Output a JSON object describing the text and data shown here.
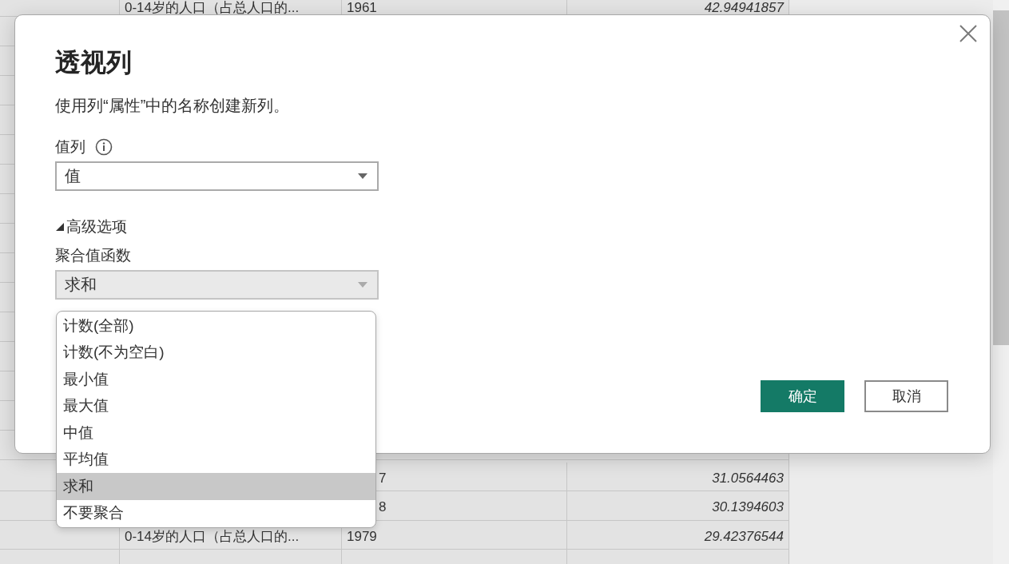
{
  "table": {
    "top_rows": [
      {
        "label": "0-14岁的人口（占总人口的...",
        "year": "1961",
        "value": "42.94941857"
      }
    ],
    "bottom_rows": [
      {
        "year": "7",
        "value": "31.0564463"
      },
      {
        "year": "8",
        "value": "30.1394603"
      },
      {
        "label": "0-14岁的人口（占总人口的...",
        "year": "1979",
        "value": "29.42376544"
      }
    ]
  },
  "dialog": {
    "title": "透视列",
    "description": "使用列“属性”中的名称创建新列。",
    "value_column": {
      "label": "值列",
      "value": "值"
    },
    "advanced": {
      "label": "高级选项",
      "expanded": true
    },
    "aggregate": {
      "label": "聚合值函数",
      "value": "求和",
      "open": true,
      "options": [
        {
          "label": "计数(全部)",
          "selected": false
        },
        {
          "label": "计数(不为空白)",
          "selected": false
        },
        {
          "label": "最小值",
          "selected": false
        },
        {
          "label": "最大值",
          "selected": false
        },
        {
          "label": "中值",
          "selected": false
        },
        {
          "label": "平均值",
          "selected": false
        },
        {
          "label": "求和",
          "selected": true
        },
        {
          "label": "不要聚合",
          "selected": false
        }
      ]
    },
    "buttons": [
      {
        "label": "确定",
        "kind": "primary"
      },
      {
        "label": "取消",
        "kind": "secondary"
      }
    ]
  }
}
